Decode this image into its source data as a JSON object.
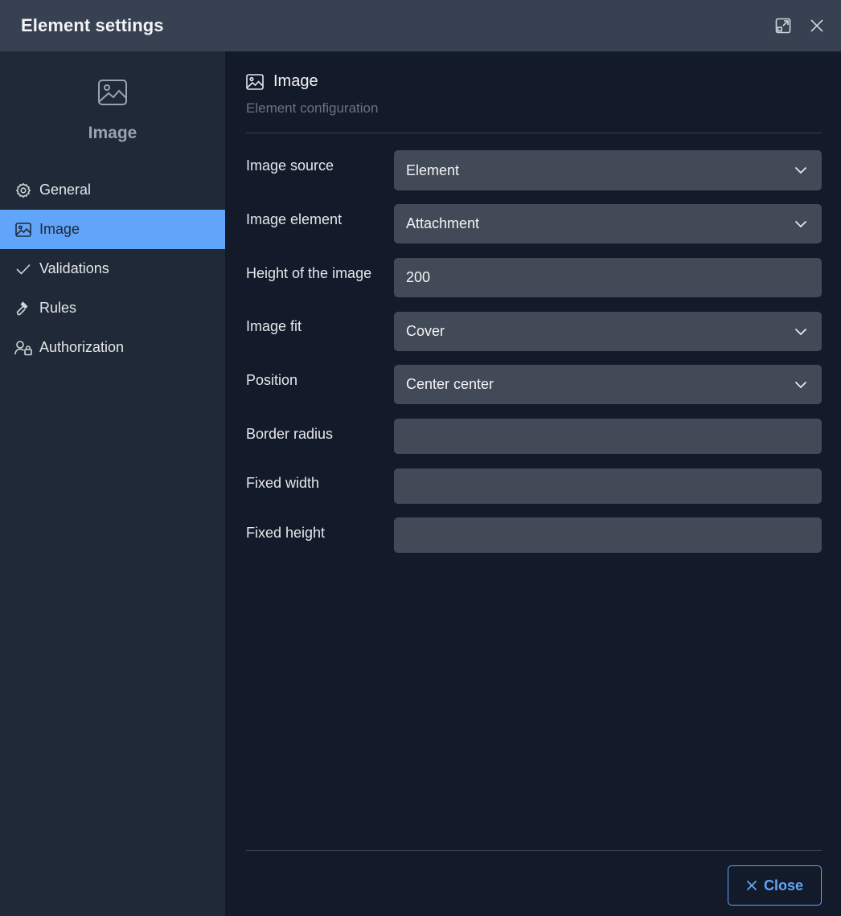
{
  "header": {
    "title": "Element settings",
    "icons": [
      "minimize-window-icon",
      "close-icon"
    ]
  },
  "sidebar": {
    "element_icon": "image-icon",
    "element_title": "Image",
    "items": [
      {
        "label": "General",
        "icon": "gear-icon",
        "active": false
      },
      {
        "label": "Image",
        "icon": "image-icon",
        "active": true
      },
      {
        "label": "Validations",
        "icon": "check-icon",
        "active": false
      },
      {
        "label": "Rules",
        "icon": "gavel-icon",
        "active": false
      },
      {
        "label": "Authorization",
        "icon": "user-lock-icon",
        "active": false
      }
    ]
  },
  "main": {
    "title": "Image",
    "subtitle": "Element configuration",
    "fields": [
      {
        "label": "Image source",
        "value": "Element",
        "type": "select"
      },
      {
        "label": "Image element",
        "value": "Attachment",
        "type": "select"
      },
      {
        "label": "Height of the image",
        "value": "200",
        "type": "input"
      },
      {
        "label": "Image fit",
        "value": "Cover",
        "type": "select"
      },
      {
        "label": "Position",
        "value": "Center center",
        "type": "select"
      },
      {
        "label": "Border radius",
        "value": "",
        "type": "input"
      },
      {
        "label": "Fixed width",
        "value": "",
        "type": "input"
      },
      {
        "label": "Fixed height",
        "value": "",
        "type": "input"
      }
    ]
  },
  "footer": {
    "close_label": "Close"
  },
  "colors": {
    "accent": "#60a5fa",
    "header_bg": "#374151",
    "sidebar_bg": "#1f2937",
    "main_bg": "#131a29",
    "field_bg": "#434a57"
  }
}
